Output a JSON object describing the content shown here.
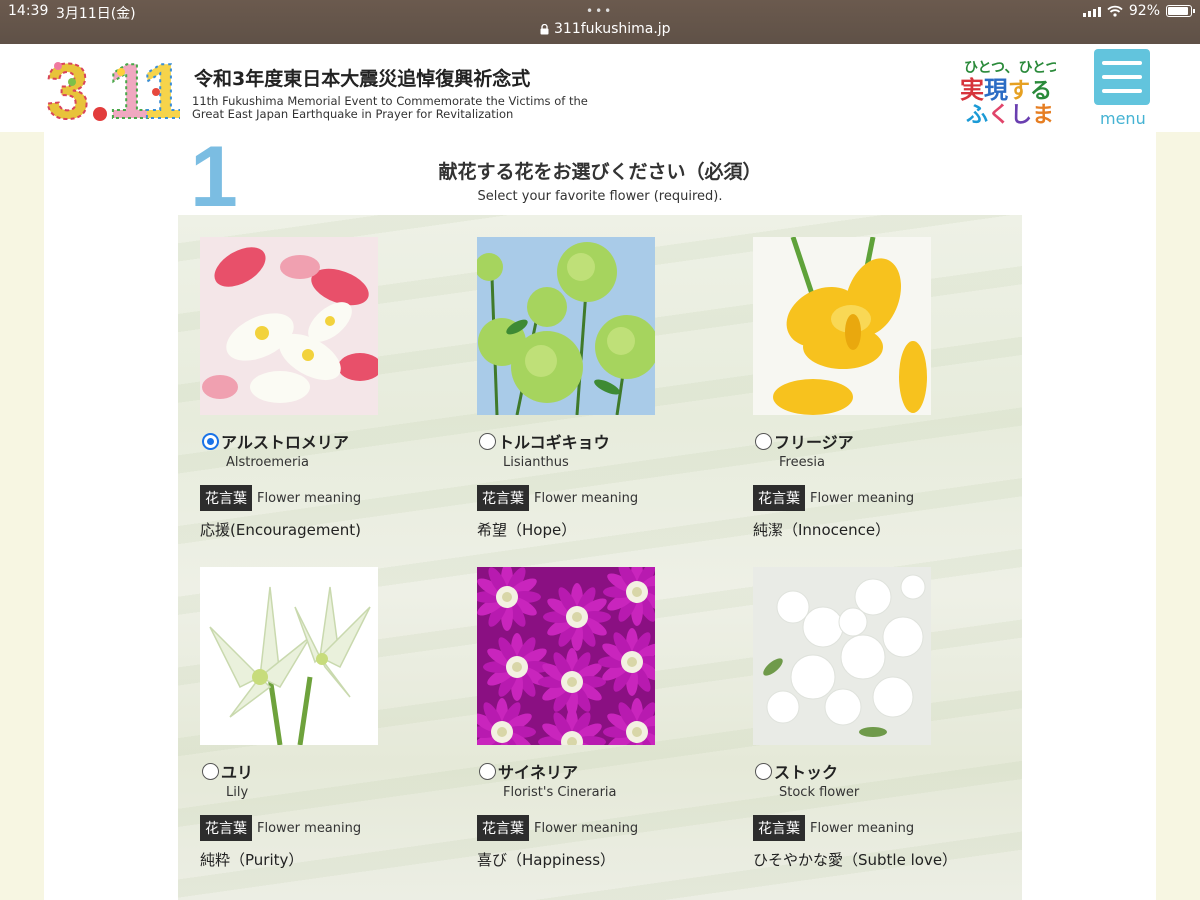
{
  "status_bar": {
    "time": "14:39",
    "date": "3月11日(金)",
    "url": "311fukushima.jp",
    "battery": "92%",
    "battery_level": 0.92
  },
  "header": {
    "logo_text": "3.11",
    "title_jp": "令和3年度東日本大震災追悼復興祈念式",
    "title_en_line1": "11th Fukushima Memorial Event to Commemorate the Victims of the",
    "title_en_line2": "Great East Japan Earthquake in Prayer for Revitalization",
    "fukushima_logo_text": "ひとつ、ひとつ、実現する ふくしま",
    "menu_label": "menu",
    "accent_color": "#62c4dd"
  },
  "section": {
    "step_number": "1",
    "title_jp": "献花する花をお選びください（必須）",
    "title_en": "Select your favorite flower (required)."
  },
  "flowers": [
    {
      "jp": "アルストロメリア",
      "en": "Alstroemeria",
      "badge": "花言葉",
      "meaning_label": "Flower meaning",
      "meaning": "応援(Encouragement)",
      "selected": true,
      "image": "alstroemeria-photo"
    },
    {
      "jp": "トルコギキョウ",
      "en": "Lisianthus",
      "badge": "花言葉",
      "meaning_label": "Flower meaning",
      "meaning": "希望（Hope）",
      "selected": false,
      "image": "lisianthus-photo"
    },
    {
      "jp": "フリージア",
      "en": "Freesia",
      "badge": "花言葉",
      "meaning_label": "Flower meaning",
      "meaning": "純潔（Innocence）",
      "selected": false,
      "image": "freesia-photo"
    },
    {
      "jp": "ユリ",
      "en": "Lily",
      "badge": "花言葉",
      "meaning_label": "Flower meaning",
      "meaning": "純粋（Purity）",
      "selected": false,
      "image": "lily-photo"
    },
    {
      "jp": "サイネリア",
      "en": "Florist's Cineraria",
      "badge": "花言葉",
      "meaning_label": "Flower meaning",
      "meaning": "喜び（Happiness）",
      "selected": false,
      "image": "cineraria-photo"
    },
    {
      "jp": "ストック",
      "en": "Stock flower",
      "badge": "花言葉",
      "meaning_label": "Flower meaning",
      "meaning": "ひそやかな愛（Subtle love）",
      "selected": false,
      "image": "stock-photo"
    }
  ]
}
